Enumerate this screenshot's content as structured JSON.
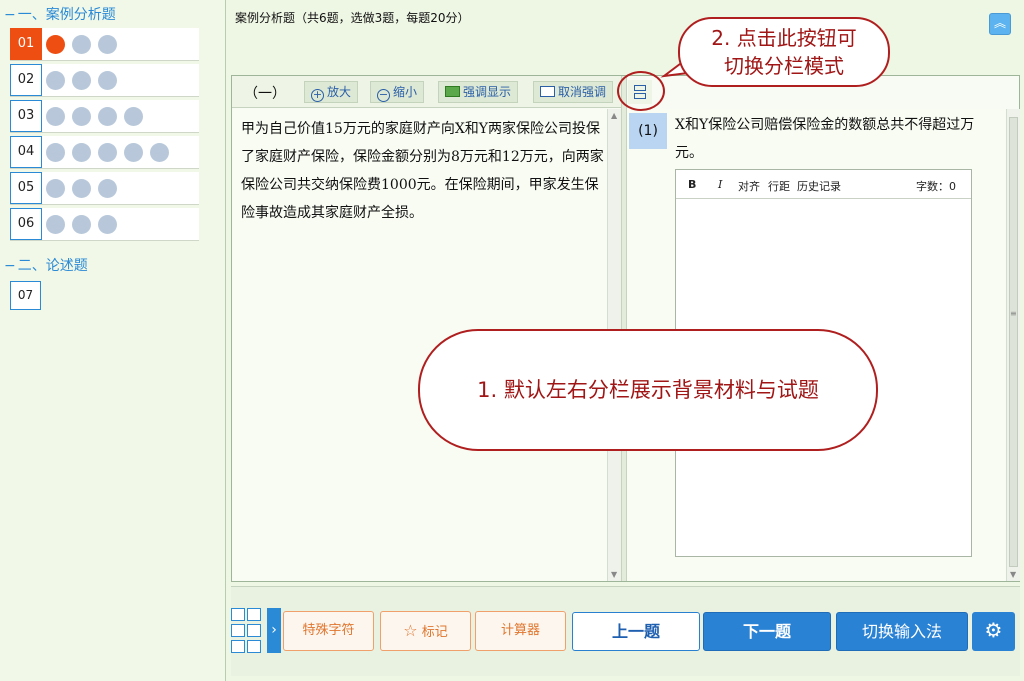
{
  "nav": {
    "section1": "一、案例分析题",
    "section2": "二、论述题",
    "questions": [
      {
        "num": "01",
        "dots": 3,
        "active": true
      },
      {
        "num": "02",
        "dots": 3
      },
      {
        "num": "03",
        "dots": 4
      },
      {
        "num": "04",
        "dots": 5
      },
      {
        "num": "05",
        "dots": 3
      },
      {
        "num": "06",
        "dots": 3
      }
    ],
    "essay": [
      {
        "num": "07"
      }
    ]
  },
  "header": {
    "title": "案例分析题（共6题，选做3题，每题20分）",
    "collapse_icon": "double-chevron-up-icon"
  },
  "toolbar": {
    "part_label": "（一）",
    "zoom_in": "放大",
    "zoom_out": "缩小",
    "highlight": "强调显示",
    "unhighlight": "取消强调"
  },
  "material": {
    "text": "甲为自己价值15万元的家庭财产向X和Y两家保险公司投保了家庭财产保险，保险金额分别为8万元和12万元，向两家保险公司共交纳保险费1000元。在保险期间，甲家发生保险事故造成其家庭财产全损。"
  },
  "question": {
    "tag": "(1)",
    "text": "X和Y保险公司赔偿保险金的数额总共不得超过万元。"
  },
  "editor": {
    "bold": "B",
    "italic": "I",
    "align": "对齐",
    "line_spacing": "行距",
    "history": "历史记录",
    "word_count": "字数：0"
  },
  "bottom": {
    "special_chars": "特殊字符",
    "mark": "标记",
    "calculator": "计算器",
    "prev": "上一题",
    "next": "下一题",
    "switch_ime": "切换输入法"
  },
  "annotations": {
    "callout1": "1. 默认左右分栏展示背景材料与试题",
    "callout2_line1": "2. 点击此按钮可",
    "callout2_line2": "切换分栏模式"
  },
  "colors": {
    "accent_blue": "#2a82d4",
    "active_orange": "#ee4e12",
    "callout_red": "#b01f1f"
  }
}
